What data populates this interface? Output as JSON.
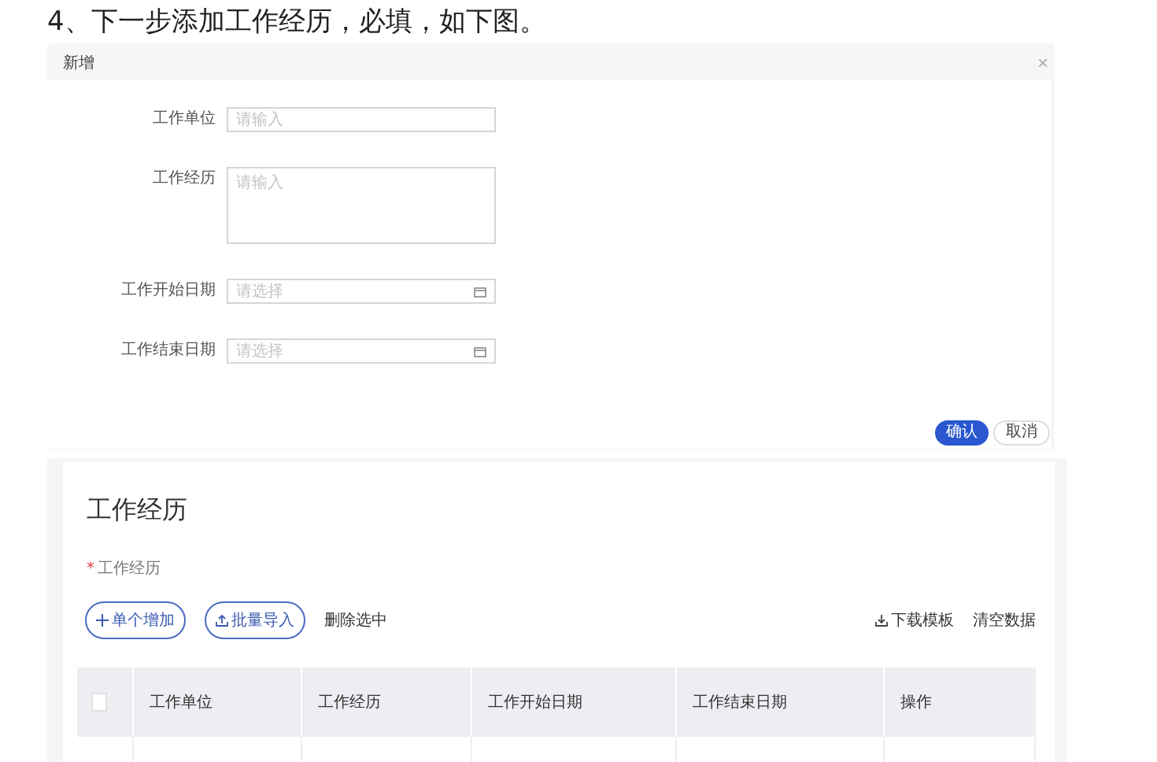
{
  "heading": "4、下一步添加工作经历，必填，如下图。",
  "dialog": {
    "title": "新增",
    "close": "×",
    "fields": [
      {
        "label": "工作单位",
        "kind": "input",
        "placeholder": "请输入"
      },
      {
        "label": "工作经历",
        "kind": "textarea",
        "placeholder": "请输入"
      },
      {
        "label": "工作开始日期",
        "kind": "date",
        "placeholder": "请选择"
      },
      {
        "label": "工作结束日期",
        "kind": "date",
        "placeholder": "请选择"
      }
    ],
    "buttons": [
      {
        "label": "确认",
        "kind": "primary"
      },
      {
        "label": "取消",
        "kind": "default"
      }
    ]
  },
  "section": {
    "title": "工作经历",
    "required_mark": "*",
    "field_label": "工作经历",
    "left_actions": [
      {
        "label": "单个增加",
        "kind": "add"
      },
      {
        "label": "批量导入",
        "kind": "import"
      },
      {
        "label": "删除选中",
        "kind": "text"
      }
    ],
    "right_actions": [
      {
        "label": "下载模板",
        "kind": "download"
      },
      {
        "label": "清空数据",
        "kind": "text"
      }
    ],
    "table": {
      "select_all": {
        "checked": false
      },
      "columns": [
        "工作单位",
        "工作经历",
        "工作开始日期",
        "工作结束日期",
        "操作"
      ]
    }
  }
}
